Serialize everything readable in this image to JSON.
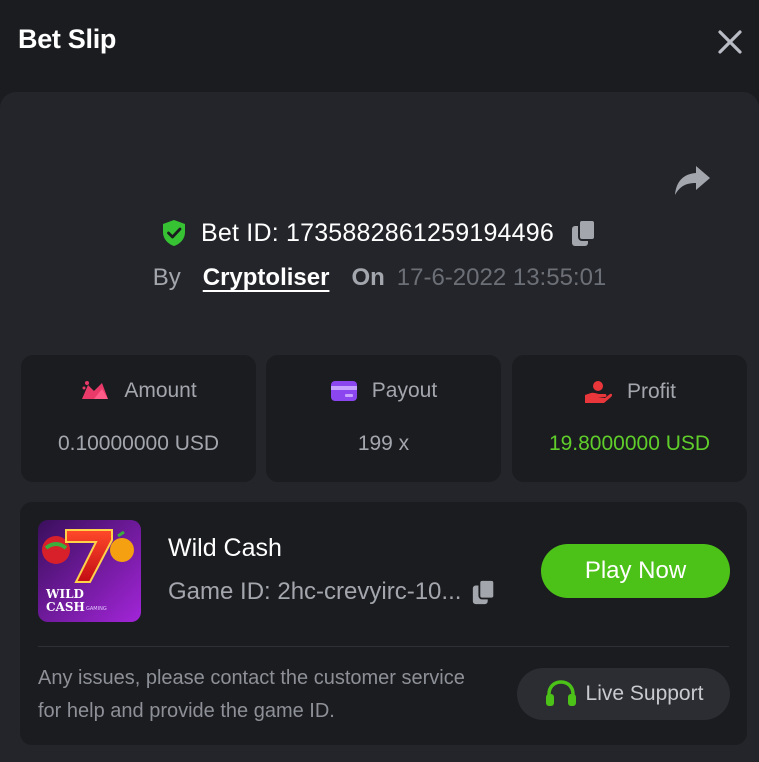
{
  "header": {
    "title": "Bet Slip"
  },
  "bet": {
    "id_label": "Bet ID: 1735882861259194496",
    "by_label": "By",
    "author": "Cryptoliser",
    "on_label": "On",
    "datetime": "17-6-2022 13:55:01"
  },
  "stats": [
    {
      "label": "Amount",
      "value": "0.10000000 USD",
      "icon": "money-bag-icon"
    },
    {
      "label": "Payout",
      "value": "199 x",
      "icon": "card-icon"
    },
    {
      "label": "Profit",
      "value": "19.8000000 USD",
      "icon": "hand-profit-icon"
    }
  ],
  "game": {
    "name": "Wild Cash",
    "id_label": "Game ID: 2hc-crevyirc-10...",
    "thumb_text_1": "WILD",
    "thumb_text_2": "CASH",
    "thumb_brand": "GAMING",
    "play_label": "Play Now",
    "help_text": "Any issues, please contact the customer service for help and provide the game ID.",
    "support_label": "Live Support"
  },
  "colors": {
    "background": "#1b1c1f",
    "panel": "#23252a",
    "card": "#1b1c20",
    "accent_green": "#4cc218",
    "profit_green": "#5fcd2a",
    "muted_text": "#a4a6ae"
  }
}
